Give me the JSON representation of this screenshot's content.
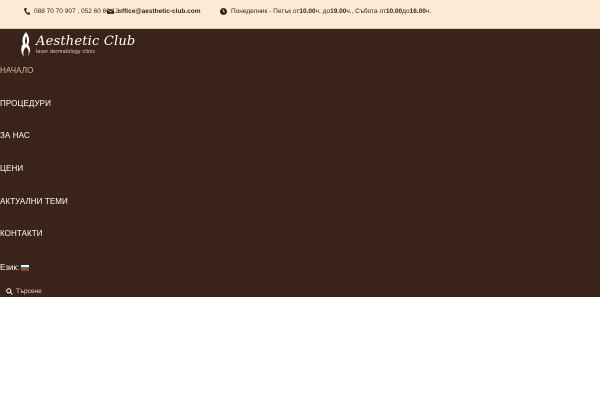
{
  "topbar": {
    "phone": "088 70 70 907 , 052 60 60 12",
    "email": "office@aesthetic-club.com",
    "hours_prefix": "Понеделник - Петък от ",
    "hours_wk_from": "10.00",
    "hours_sep1": "ч. до ",
    "hours_wk_to": "19.00",
    "hours_mid": "ч., Събота от ",
    "hours_sat_from": "10.00",
    "hours_sep2": " до ",
    "hours_sat_to": "16.00",
    "hours_suffix": "ч."
  },
  "logo": {
    "name": "Aesthetic Club",
    "tagline": "laser dermatology clinic"
  },
  "nav": {
    "items": [
      {
        "label": "НАЧАЛО"
      },
      {
        "label": "ПРОЦЕДУРИ"
      },
      {
        "label": "ЗА НАС"
      },
      {
        "label": "ЦЕНИ"
      },
      {
        "label": "АКТУАЛНИ ТЕМИ"
      },
      {
        "label": "КОНТАКТИ"
      }
    ],
    "active_index": 0
  },
  "language": {
    "label": "Език:",
    "flag_icon": "bulgaria-flag-icon"
  },
  "search": {
    "placeholder": "Търсене"
  },
  "colors": {
    "topbar_bg": "#fcebd4",
    "header_bg": "#3a2419",
    "active_nav": "#d4b8a0"
  }
}
